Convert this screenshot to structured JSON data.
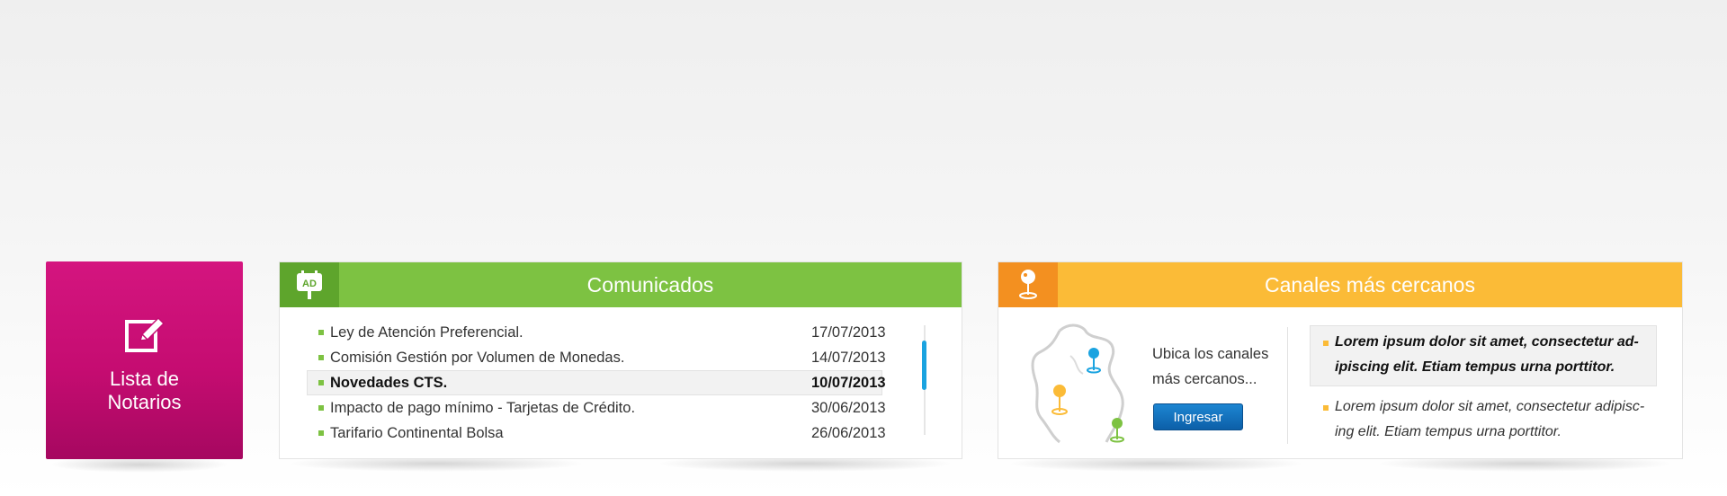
{
  "tile": {
    "label_line1": "Lista de",
    "label_line2": "Notarios",
    "icon": "edit-icon",
    "color": "#c50c71"
  },
  "comunicados": {
    "title": "Comunicados",
    "icon": "ad-billboard-icon",
    "accent": "#7dc242",
    "items": [
      {
        "title": "Ley de Atención Preferencial.",
        "date": "17/07/2013"
      },
      {
        "title": "Comisión Gestión por Volumen de Monedas.",
        "date": "14/07/2013"
      },
      {
        "title": "Novedades CTS.",
        "date": "10/07/2013"
      },
      {
        "title": "Impacto de pago mínimo - Tarjetas de Crédito.",
        "date": "30/06/2013"
      },
      {
        "title": "Tarifario Continental Bolsa",
        "date": "26/06/2013"
      }
    ],
    "active_index": 2
  },
  "canales": {
    "title": "Canales más cercanos",
    "icon": "map-pin-icon",
    "accent": "#fbbb37",
    "text_line1": "Ubica los canales",
    "text_line2": "más cercanos...",
    "button_label": "Ingresar",
    "lorem1_line1": "Lorem ipsum dolor sit amet, consectetur ad-",
    "lorem1_line2": "ipiscing elit. Etiam tempus urna porttitor.",
    "lorem2_line1": "Lorem ipsum dolor sit amet, consectetur adipisc-",
    "lorem2_line2": "ing elit. Etiam tempus urna porttitor."
  }
}
